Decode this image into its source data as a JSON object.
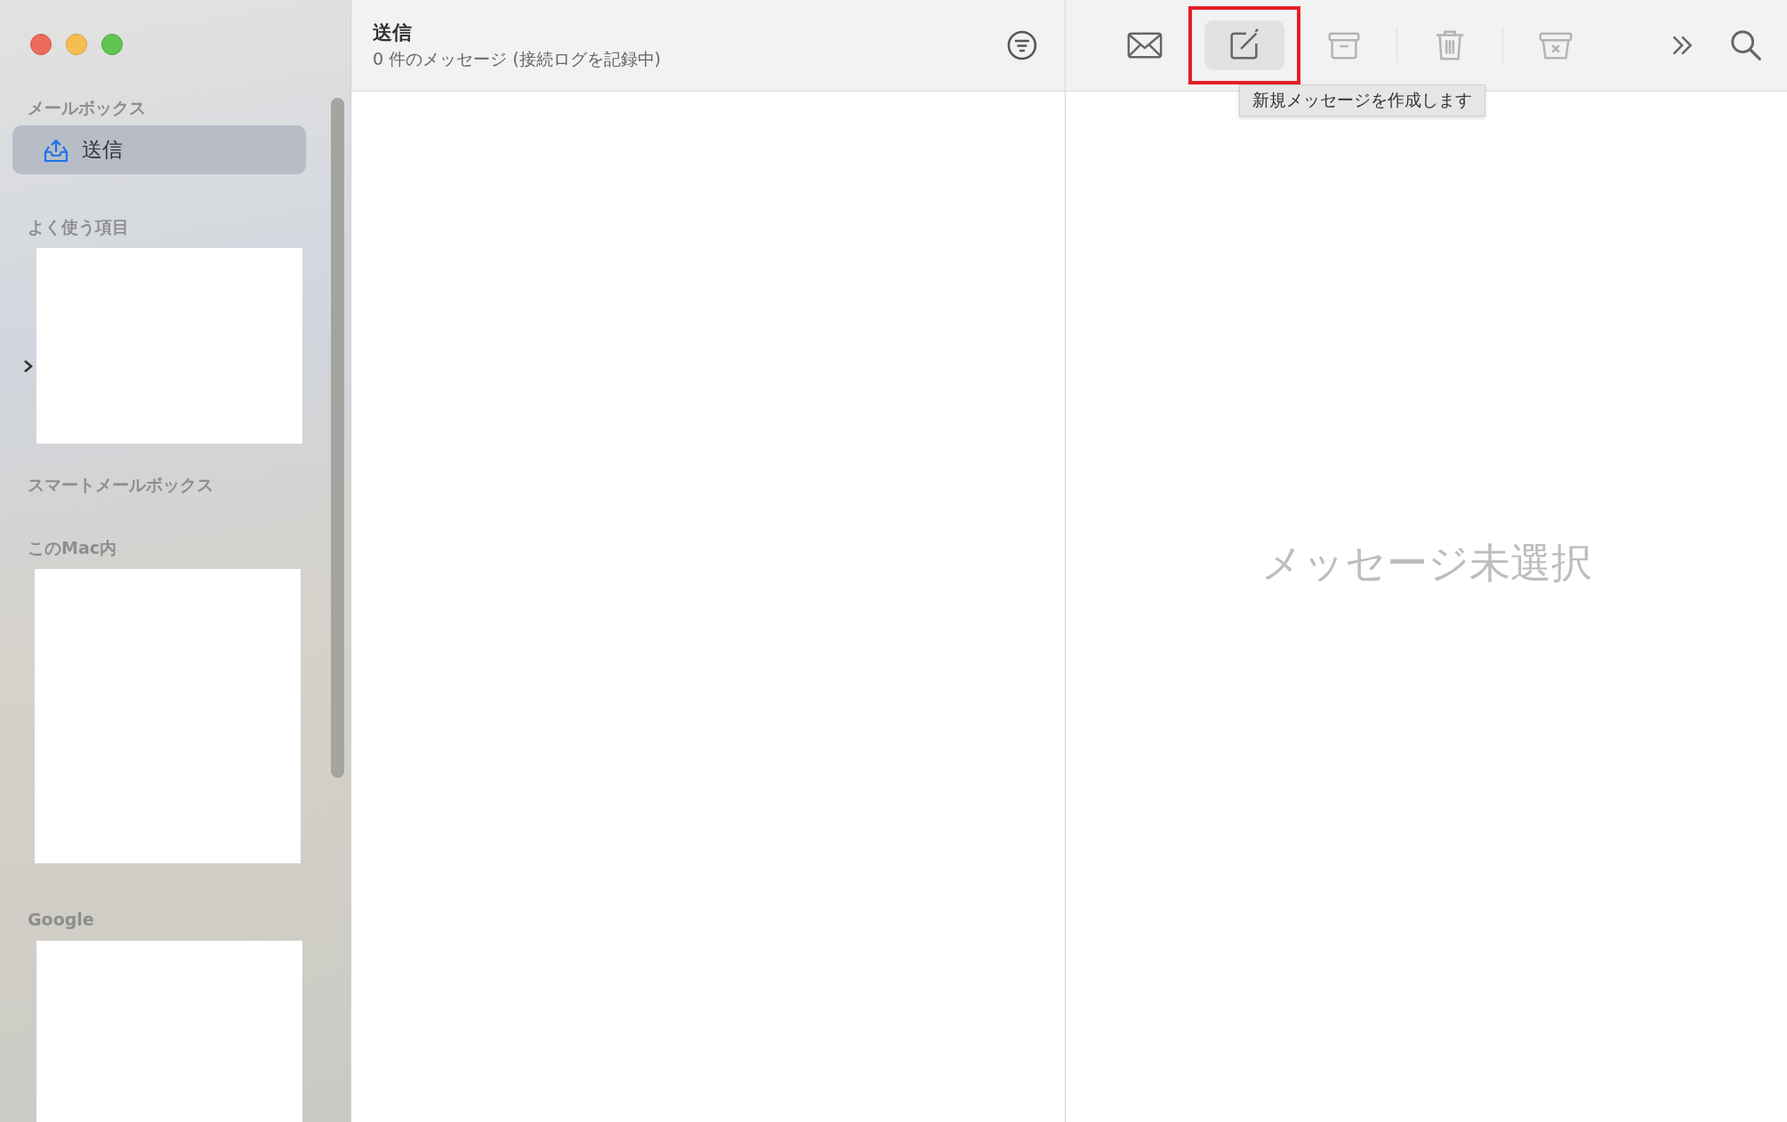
{
  "sidebar": {
    "sections": [
      {
        "title": "メールボックス",
        "items": [
          {
            "label": "送信",
            "selected": true
          }
        ]
      },
      {
        "title": "よく使う項目",
        "hidden_content": true
      },
      {
        "title": "スマートメールボックス"
      },
      {
        "title": "このMac内",
        "hidden_content": true
      },
      {
        "title": "Google",
        "hidden_content": true
      }
    ]
  },
  "message_list": {
    "title": "送信",
    "subtitle": "0 件のメッセージ (接続ログを記録中)"
  },
  "toolbar": {
    "items": [
      {
        "kind": "get-mail",
        "disabled": false,
        "highlighted": false,
        "hovered": false
      },
      {
        "kind": "compose",
        "disabled": false,
        "highlighted": true,
        "hovered": true,
        "tooltip": "新規メッセージを作成します"
      },
      {
        "kind": "archive",
        "disabled": true,
        "highlighted": false,
        "hovered": false
      },
      {
        "kind": "divider"
      },
      {
        "kind": "trash",
        "disabled": true,
        "highlighted": false,
        "hovered": false
      },
      {
        "kind": "divider"
      },
      {
        "kind": "junk",
        "disabled": true,
        "highlighted": false,
        "hovered": false
      },
      {
        "kind": "spacer"
      },
      {
        "kind": "more",
        "disabled": false,
        "highlighted": false,
        "hovered": false
      },
      {
        "kind": "search",
        "disabled": false,
        "highlighted": false,
        "hovered": false
      }
    ]
  },
  "message_view": {
    "empty_text": "メッセージ未選択"
  }
}
